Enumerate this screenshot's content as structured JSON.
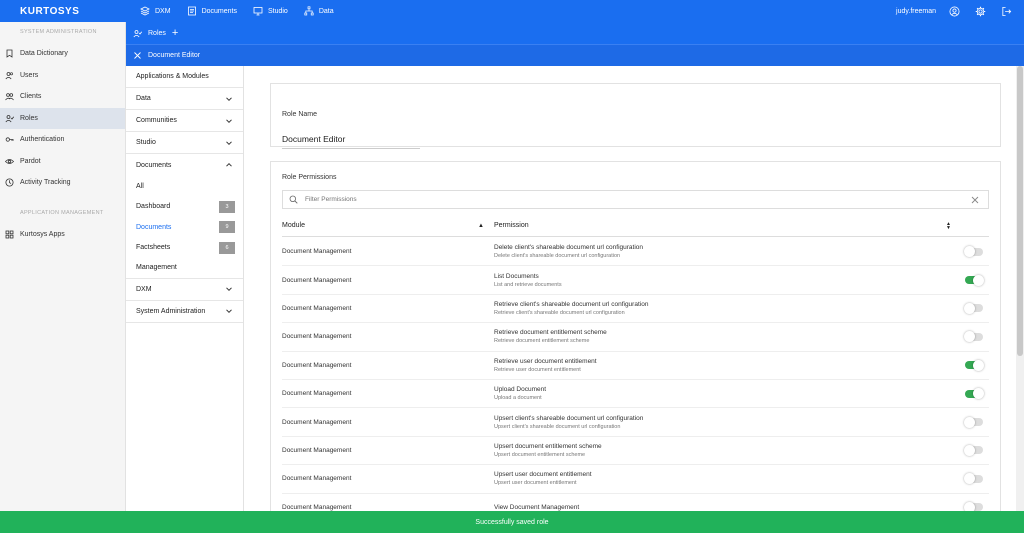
{
  "brand": "KURTOSYS",
  "top_nav": [
    {
      "label": "DXM",
      "icon": "layers-icon"
    },
    {
      "label": "Documents",
      "icon": "documents-icon"
    },
    {
      "label": "Studio",
      "icon": "studio-icon"
    },
    {
      "label": "Data",
      "icon": "data-icon"
    }
  ],
  "user": {
    "name": "judy.freeman"
  },
  "sidebar": {
    "section1": "SYSTEM ADMINISTRATION",
    "items1": [
      {
        "label": "Data Dictionary",
        "icon": "bookmark-icon"
      },
      {
        "label": "Users",
        "icon": "users-icon"
      },
      {
        "label": "Clients",
        "icon": "clients-icon"
      },
      {
        "label": "Roles",
        "icon": "roles-icon"
      },
      {
        "label": "Authentication",
        "icon": "key-icon"
      },
      {
        "label": "Pardot",
        "icon": "eye-icon"
      },
      {
        "label": "Activity Tracking",
        "icon": "clock-icon"
      }
    ],
    "section2": "APPLICATION MANAGEMENT",
    "items2": [
      {
        "label": "Kurtosys Apps",
        "icon": "apps-icon"
      }
    ]
  },
  "subheader": {
    "roles_label": "Roles",
    "editor_label": "Document Editor"
  },
  "tree": {
    "header": "Applications & Modules",
    "groups": [
      {
        "label": "Data"
      },
      {
        "label": "Communities"
      },
      {
        "label": "Studio"
      },
      {
        "label": "Documents"
      }
    ],
    "documents_children": [
      {
        "label": "All",
        "badge": ""
      },
      {
        "label": "Dashboard",
        "badge": "3"
      },
      {
        "label": "Documents",
        "badge": "9"
      },
      {
        "label": "Factsheets",
        "badge": "6"
      },
      {
        "label": "Management",
        "badge": ""
      }
    ],
    "groups_after": [
      {
        "label": "DXM"
      },
      {
        "label": "System Administration"
      }
    ]
  },
  "role_name": {
    "label": "Role Name",
    "value": "Document Editor"
  },
  "permissions": {
    "label": "Role Permissions",
    "filter_placeholder": "Filter Permissions",
    "col_module": "Module",
    "col_permission": "Permission",
    "rows": [
      {
        "module": "Document Management",
        "title": "Delete client's shareable document url configuration",
        "desc": "Delete client's shareable document url configuration",
        "enabled": false
      },
      {
        "module": "Document Management",
        "title": "List Documents",
        "desc": "List and retrieve documents",
        "enabled": true
      },
      {
        "module": "Document Management",
        "title": "Retrieve client's shareable document url configuration",
        "desc": "Retrieve client's shareable document url configuration",
        "enabled": false
      },
      {
        "module": "Document Management",
        "title": "Retrieve document entitlement scheme",
        "desc": "Retrieve document entitlement scheme",
        "enabled": false
      },
      {
        "module": "Document Management",
        "title": "Retrieve user document entitlement",
        "desc": "Retrieve user document entitlement",
        "enabled": true
      },
      {
        "module": "Document Management",
        "title": "Upload Document",
        "desc": "Upload a document",
        "enabled": true
      },
      {
        "module": "Document Management",
        "title": "Upsert client's shareable document url configuration",
        "desc": "Upsert client's shareable document url configuration",
        "enabled": false
      },
      {
        "module": "Document Management",
        "title": "Upsert document entitlement scheme",
        "desc": "Upsert document entitlement scheme",
        "enabled": false
      },
      {
        "module": "Document Management",
        "title": "Upsert user document entitlement",
        "desc": "Upsert user document entitlement",
        "enabled": false
      },
      {
        "module": "Document Management",
        "title": "View Document Management",
        "desc": "",
        "enabled": false
      }
    ]
  },
  "toast": "Successfully saved role",
  "colors": {
    "primary": "#1a6ef0",
    "success": "#21b25a",
    "toggle_on": "#34a853"
  }
}
